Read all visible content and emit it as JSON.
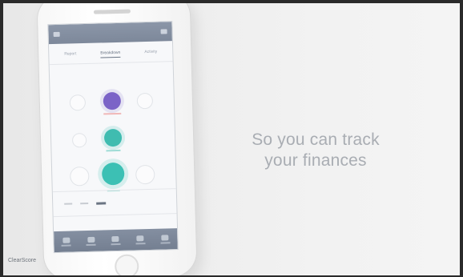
{
  "tagline": "So you can track\nyour finances",
  "watermark": "ClearScore",
  "app": {
    "segments": [
      "Report",
      "Breakdown",
      "Activity"
    ],
    "active_segment": 1,
    "nodes": {
      "purple_label": "",
      "teal_label": "",
      "teal_large_label": ""
    }
  },
  "colors": {
    "purple": "#7b63c7",
    "teal": "#3fbcb0",
    "bar": "#7d889a"
  }
}
